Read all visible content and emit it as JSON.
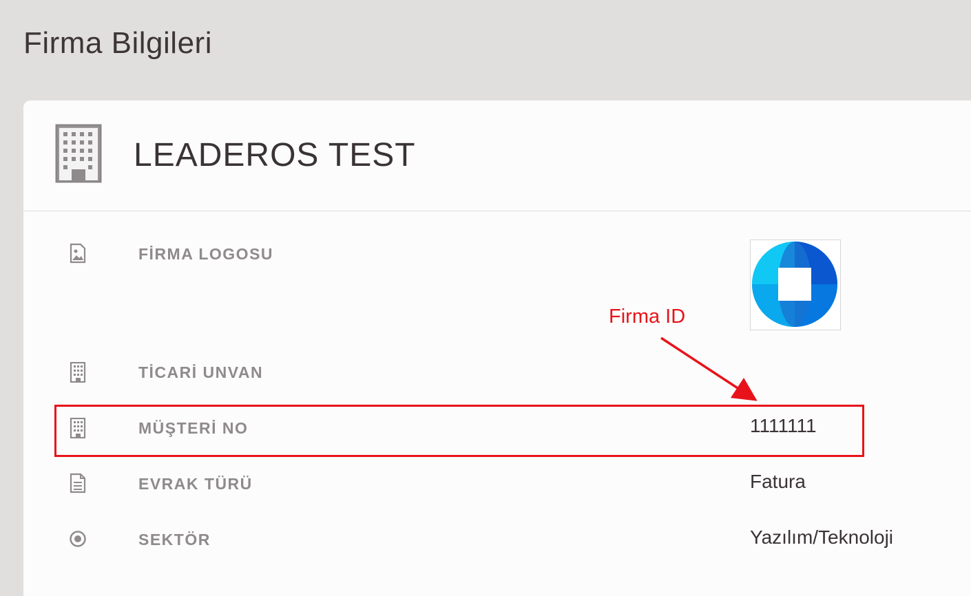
{
  "page": {
    "title": "Firma Bilgileri"
  },
  "company": {
    "name": "LEADEROS TEST",
    "icon": "building-icon"
  },
  "fields": [
    {
      "label": "FİRMA LOGOSU",
      "icon": "image-icon",
      "value": ""
    },
    {
      "label": "TİCARİ UNVAN",
      "icon": "building-icon",
      "value": ""
    },
    {
      "label": "MÜŞTERİ NO",
      "icon": "building-icon",
      "value": "1111111"
    },
    {
      "label": "EVRAK TÜRÜ",
      "icon": "document-icon",
      "value": "Fatura"
    },
    {
      "label": "SEKTÖR",
      "icon": "radio-target-icon",
      "value": "Yazılım/Teknoloji"
    }
  ],
  "annotation": {
    "label": "Firma ID",
    "color": "#e8131a"
  },
  "colors": {
    "background": "#e0dfde",
    "card": "#fcfcfc",
    "label": "#8f8a8b",
    "text": "#3a3335",
    "annotation": "#e8131a"
  }
}
